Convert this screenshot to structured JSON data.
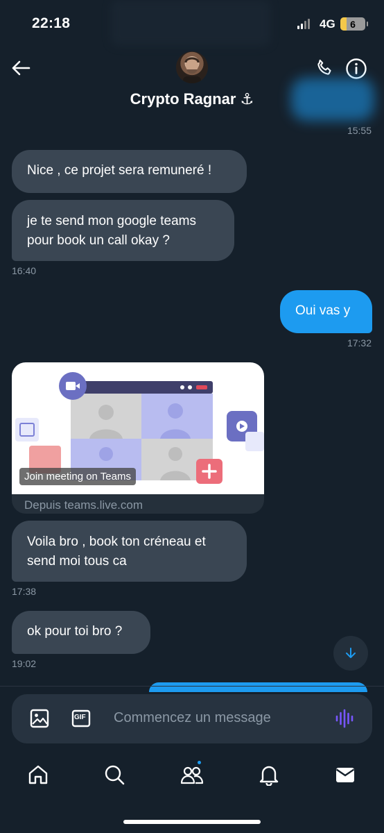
{
  "status_bar": {
    "time": "22:18",
    "network": "4G",
    "battery": "6"
  },
  "header": {
    "contact_name": "Crypto Ragnar ⚓"
  },
  "colors": {
    "background": "#15202b",
    "received_bubble": "#3a4653",
    "sent_bubble": "#1d9bf0",
    "muted_text": "#8b98a5"
  },
  "messages": [
    {
      "time": "15:55"
    },
    {
      "text": "Nice , ce projet sera remuneré !"
    },
    {
      "text_line1": "je te send mon google teams",
      "text_line2": "pour book un call okay ?",
      "time": "16:40"
    },
    {
      "text": "Oui vas y",
      "time": "17:32"
    },
    {
      "card_overlay": "Join meeting on Teams",
      "card_domain": "Depuis teams.live.com"
    },
    {
      "text_line1": "Voila bro , book ton créneau et",
      "text_line2": "send moi tous ca",
      "time": "17:38"
    },
    {
      "text": "ok pour toi bro ?",
      "time": "19:02"
    }
  ],
  "composer": {
    "placeholder": "Commencez un message",
    "gif_label": "GIF"
  },
  "icons": [
    "back-arrow-icon",
    "phone-icon",
    "info-icon",
    "image-icon",
    "gif-icon",
    "voice-icon",
    "home-icon",
    "search-icon",
    "communities-icon",
    "notifications-icon",
    "messages-icon",
    "scroll-down-icon"
  ]
}
